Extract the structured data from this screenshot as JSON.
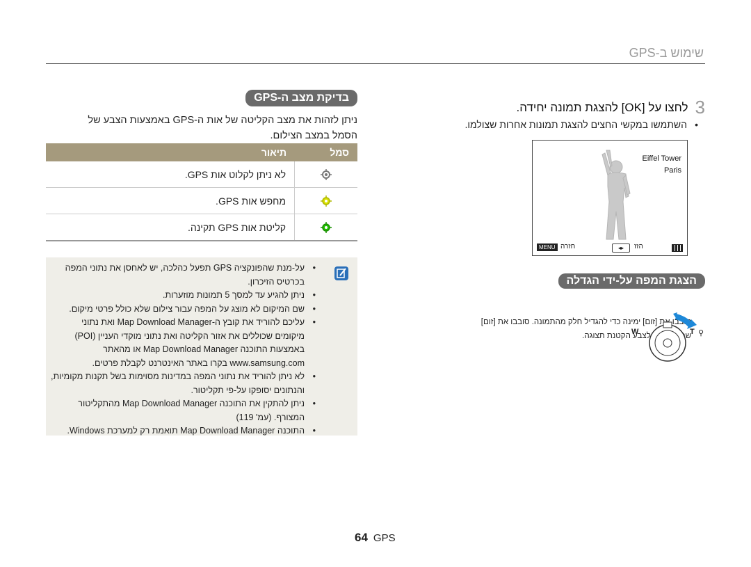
{
  "header": {
    "title": "שימוש ב-GPS"
  },
  "step3": {
    "number": "3",
    "text": "לחצו על [OK] להצגת תמונה יחידה.",
    "bullet": "השתמשו במקשי החצים להצגת תמונות אחרות שצולמו."
  },
  "camera_screen": {
    "landmark": "Eiffel Tower",
    "city": "Paris",
    "menu_label": "MENU",
    "menu_text": "חזרה",
    "nav_text": "הזז"
  },
  "zoom_section": {
    "heading": "הצגת המפה על-ידי הגדלה",
    "line1": "סובבו את [זום] ימינה כדי להגדיל חלק מהתמונה. סובבו את [זום]",
    "line2": "שמאלה כדי לצבע הקטנת תצוגה.",
    "w_label": "W",
    "t_label": "T"
  },
  "gps_section": {
    "heading": "בדיקת מצב ה-GPS",
    "desc_line1": "ניתן לזהות את מצב הקליטה של אות ה-GPS באמצעות הצבע של",
    "desc_line2": "הסמל במצב הצילום.",
    "table": {
      "col_icon": "סמל",
      "col_desc": "תיאור",
      "rows": [
        {
          "icon_color": "#777777",
          "desc": "לא ניתן לקלוט אות GPS."
        },
        {
          "icon_color": "#d8e000",
          "desc": "מחפש אות GPS."
        },
        {
          "icon_color": "#22c000",
          "desc": "קליטת אות GPS תקינה."
        }
      ]
    }
  },
  "notes": [
    "על-מנת שהפונקציה GPS תפעל כהלכה, יש לאחסן את נתוני המפה בכרטיס הזיכרון.",
    "ניתן להגיע עד למסך 5 תמונות מוזערות.",
    "שם המיקום לא מוצג על המפה עבור צילום שלא כולל פרטי מיקום.",
    "עליכם להוריד את קובץ ה-Map Download Manager ואת נתוני מיקומים שכוללים את אזור הקליטה ואת נתוני מוקדי העניין (POI) באמצעות התוכנה Map Download Manager או מהאתר www.samsung.com בקרו באתר האינטרנט לקבלת פרטים.",
    "לא ניתן להוריד את נתוני המפה במדינות מסוימות בשל תקנות מקומיות, והנתונים יסופקו על-פי תקליטור.",
    "ניתן להתקין את התוכנה Map Download Manager מהתקליטור המצורף. (עמ' 119)",
    "התוכנה Map Download Manager תואמת רק למערכת Windows."
  ],
  "footer": {
    "label": "GPS",
    "page": "64"
  }
}
